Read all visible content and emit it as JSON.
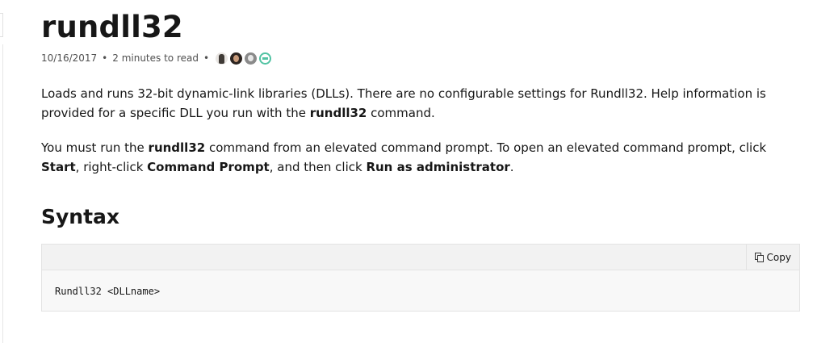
{
  "article": {
    "title": "rundll32",
    "date": "10/16/2017",
    "separator": "•",
    "read_time": "2 minutes to read",
    "contributors": [
      "contributor-avatar-1",
      "contributor-avatar-2",
      "contributor-avatar-3",
      "contributor-avatar-4"
    ]
  },
  "paragraph1": {
    "text_before": "Loads and runs 32-bit dynamic-link libraries (DLLs). There are no configurable settings for Rundll32. Help information is provided for a specific DLL you run with the ",
    "bold1": "rundll32",
    "text_after": " command."
  },
  "paragraph2": {
    "t1": "You must run the ",
    "b1": "rundll32",
    "t2": " command from an elevated command prompt. To open an elevated command prompt, click ",
    "b2": "Start",
    "t3": ", right-click ",
    "b3": "Command Prompt",
    "t4": ", and then click ",
    "b4": "Run as administrator",
    "t5": "."
  },
  "syntax": {
    "heading": "Syntax",
    "copy_label": "Copy",
    "copy_icon": "copy-icon",
    "code": "Rundll32 <DLLname>"
  },
  "colors": {
    "text": "#171717",
    "meta": "#505050",
    "code_bg": "#f8f8f8",
    "code_header_bg": "#f2f2f2",
    "border": "#e3e3e3",
    "contributor_accent": "#52c3a3"
  }
}
